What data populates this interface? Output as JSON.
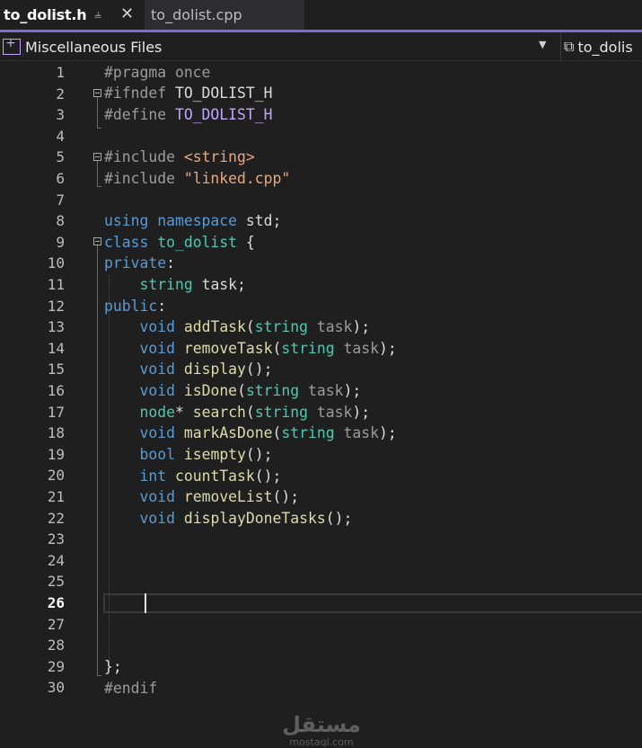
{
  "tabs": {
    "active": {
      "name": "to_dolist.h",
      "pin_icon": "pin-icon",
      "close_icon": "close-icon"
    },
    "inactive": {
      "name": "to_dolist.cpp"
    }
  },
  "navbar": {
    "project": "Miscellaneous Files",
    "scope": "to_dolis"
  },
  "editor": {
    "current_line": 26,
    "line_numbers": [
      "1",
      "2",
      "3",
      "4",
      "5",
      "6",
      "7",
      "8",
      "9",
      "10",
      "11",
      "12",
      "13",
      "14",
      "15",
      "16",
      "17",
      "18",
      "19",
      "20",
      "21",
      "22",
      "23",
      "24",
      "25",
      "26",
      "27",
      "28",
      "29",
      "30"
    ]
  },
  "code": {
    "l1": {
      "a": "#pragma",
      "b": " once"
    },
    "l2": {
      "a": "#ifndef",
      "b": " ",
      "c": "TO_DOLIST_H"
    },
    "l3": {
      "a": "#define",
      "b": " ",
      "c": "TO_DOLIST_H"
    },
    "l5": {
      "a": "#include",
      "b": " ",
      "c": "<string>"
    },
    "l6": {
      "a": "#include",
      "b": " ",
      "c": "\"linked.cpp\""
    },
    "l8": {
      "a": "using",
      "b": " ",
      "c": "namespace",
      "d": " ",
      "e": "std",
      ";": ";"
    },
    "l9": {
      "a": "class",
      "b": " ",
      "c": "to_dolist",
      "d": " {"
    },
    "l10": {
      "a": "private",
      ":": ":"
    },
    "l11": {
      "i": "    ",
      "a": "string",
      "b": " task;"
    },
    "l12": {
      "a": "public",
      ":": ":"
    },
    "l13": {
      "i": "    ",
      "a": "void",
      "b": " ",
      "c": "addTask",
      "d": "(",
      "e": "string",
      "f": " ",
      "g": "task",
      "h": ");"
    },
    "l14": {
      "i": "    ",
      "a": "void",
      "b": " ",
      "c": "removeTask",
      "d": "(",
      "e": "string",
      "f": " ",
      "g": "task",
      "h": ");"
    },
    "l15": {
      "i": "    ",
      "a": "void",
      "b": " ",
      "c": "display",
      "h": "();"
    },
    "l16": {
      "i": "    ",
      "a": "void",
      "b": " ",
      "c": "isDone",
      "d": "(",
      "e": "string",
      "f": " ",
      "g": "task",
      "h": ");"
    },
    "l17": {
      "i": "    ",
      "a": "node",
      "s": "*",
      "b": " ",
      "c": "search",
      "d": "(",
      "e": "string",
      "f": " ",
      "g": "task",
      "h": ");"
    },
    "l18": {
      "i": "    ",
      "a": "void",
      "b": " ",
      "c": "markAsDone",
      "d": "(",
      "e": "string",
      "f": " ",
      "g": "task",
      "h": ");"
    },
    "l19": {
      "i": "    ",
      "a": "bool",
      "b": " ",
      "c": "isempty",
      "h": "();"
    },
    "l20": {
      "i": "    ",
      "a": "int",
      "b": " ",
      "c": "countTask",
      "h": "();"
    },
    "l21": {
      "i": "    ",
      "a": "void",
      "b": " ",
      "c": "removeList",
      "h": "();"
    },
    "l22": {
      "i": "    ",
      "a": "void",
      "b": " ",
      "c": "displayDoneTasks",
      "h": "();"
    },
    "l29": {
      "a": "};"
    },
    "l30": {
      "a": "#endif"
    }
  },
  "watermark": {
    "arabic": "مستقل",
    "latin": "mostaql.com"
  },
  "colors": {
    "accent": "#7c6ad6",
    "keyword": "#569cd6",
    "type": "#4ec9b0",
    "function": "#dcdcaa",
    "string": "#e8a87c",
    "parameter": "#9cdcfe",
    "macro": "#bfa6ff"
  }
}
